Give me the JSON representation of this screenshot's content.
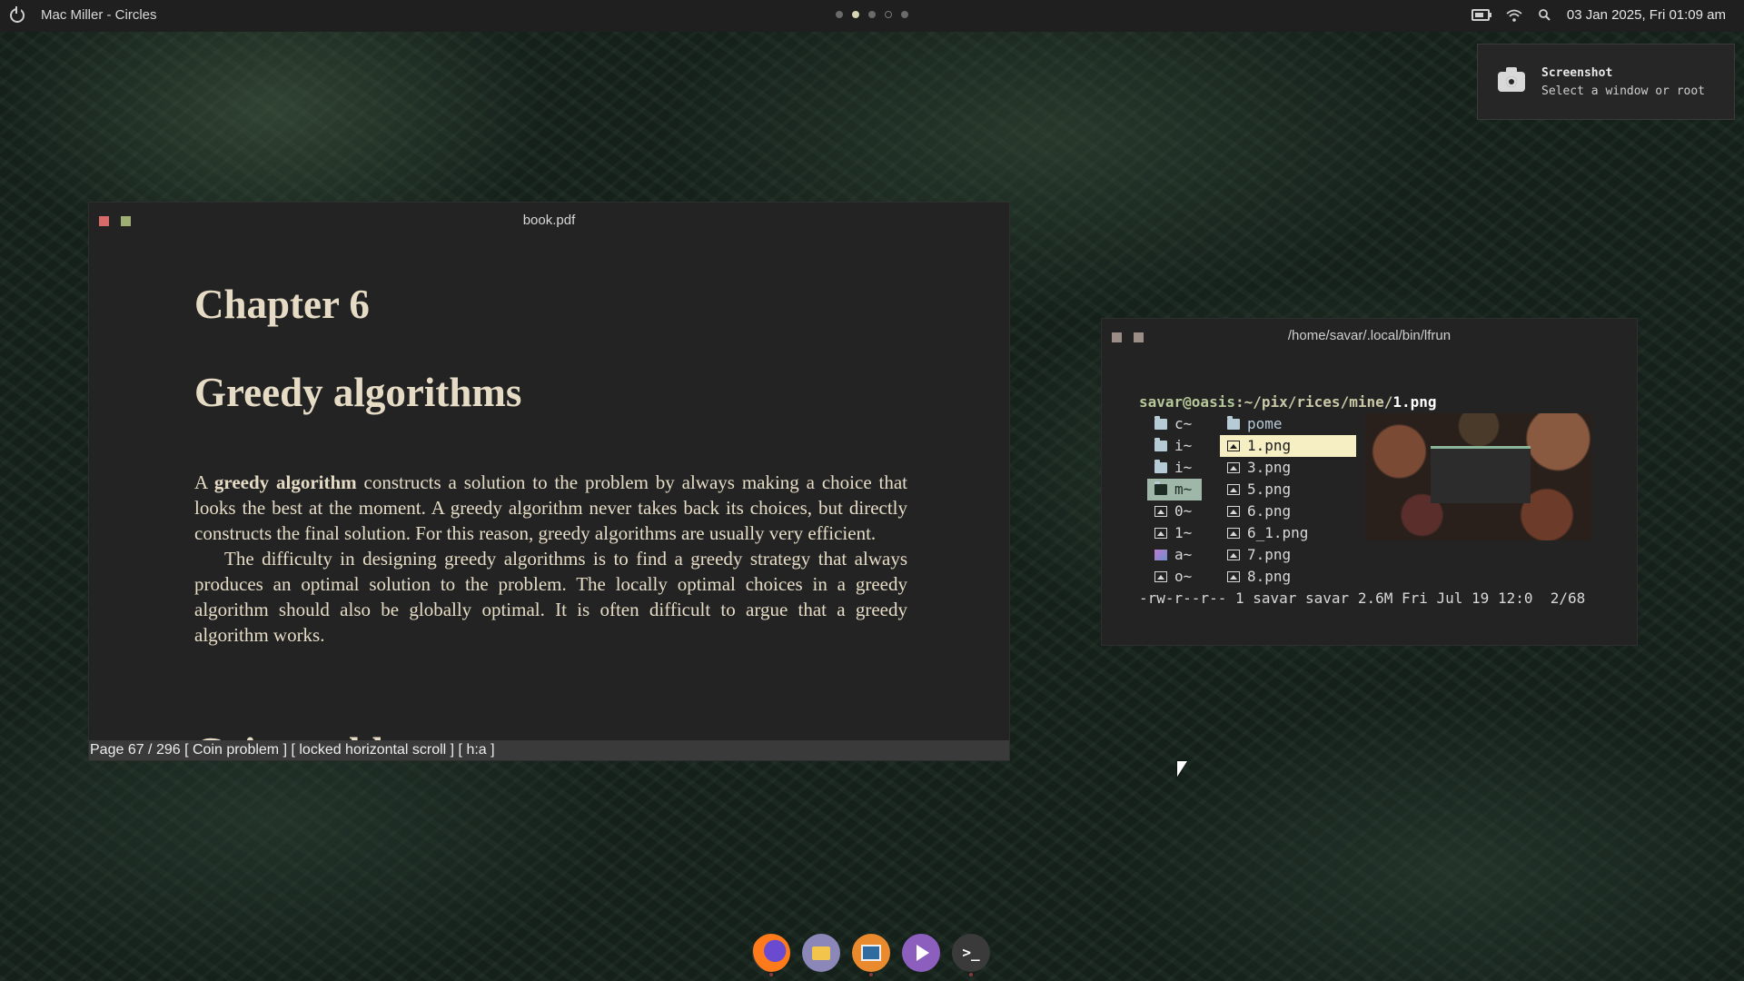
{
  "topbar": {
    "now_playing": "Mac Miller - Circles",
    "clock": "03 Jan 2025, Fri 01:09 am",
    "workspaces": [
      "inactive",
      "active",
      "inactive",
      "hollow",
      "inactive"
    ]
  },
  "notification": {
    "title": "Screenshot",
    "body": "Select a window or root"
  },
  "pdf_window": {
    "title": "book.pdf",
    "chapter": "Chapter 6",
    "section": "Greedy algorithms",
    "para1_lead": "A ",
    "para1_bold": "greedy algorithm",
    "para1_rest": " constructs a solution to the problem by always making a choice that looks the best at the moment. A greedy algorithm never takes back its choices, but directly constructs the final solution. For this reason, greedy algorithms are usually very efficient.",
    "para2": "The difficulty in designing greedy algorithms is to find a greedy strategy that always produces an optimal solution to the problem. The locally optimal choices in a greedy algorithm should also be globally optimal. It is often difficult to argue that a greedy algorithm works.",
    "next_heading": "Coin problem",
    "statusline": "Page 67 / 296 [ Coin problem ]  [ locked horizontal scroll ] [ h:a ]",
    "button_colors": {
      "close": "#d86a6a",
      "max": "#9fae74"
    }
  },
  "terminal_window": {
    "title": "/home/savar/.local/bin/lfrun",
    "prompt_user": "savar@oasis",
    "prompt_path": ":~/pix/rices/mine/",
    "prompt_file": "1.png",
    "parent_dirs": [
      {
        "name": "c~",
        "icon": "folder"
      },
      {
        "name": "i~",
        "icon": "folder"
      },
      {
        "name": "i~",
        "icon": "folder"
      },
      {
        "name": "m~",
        "icon": "folder",
        "selected": true
      },
      {
        "name": "0~",
        "icon": "image"
      },
      {
        "name": "1~",
        "icon": "image"
      },
      {
        "name": "a~",
        "icon": "color-image"
      },
      {
        "name": "o~",
        "icon": "image"
      }
    ],
    "files": [
      {
        "name": "pome",
        "icon": "folder"
      },
      {
        "name": "1.png",
        "icon": "image",
        "current": true
      },
      {
        "name": "3.png",
        "icon": "image"
      },
      {
        "name": "5.png",
        "icon": "image"
      },
      {
        "name": "6.png",
        "icon": "image"
      },
      {
        "name": "6_1.png",
        "icon": "image"
      },
      {
        "name": "7.png",
        "icon": "image"
      },
      {
        "name": "8.png",
        "icon": "image"
      }
    ],
    "file_info": "-rw-r--r-- 1 savar savar 2.6M Fri Jul 19 12:0  2/68",
    "button_color": "#9a8e86"
  },
  "dock": {
    "apps": [
      "firefox-icon",
      "files-icon",
      "reader-icon",
      "player-icon",
      "terminal-icon"
    ],
    "terminal_glyph": ">_"
  }
}
